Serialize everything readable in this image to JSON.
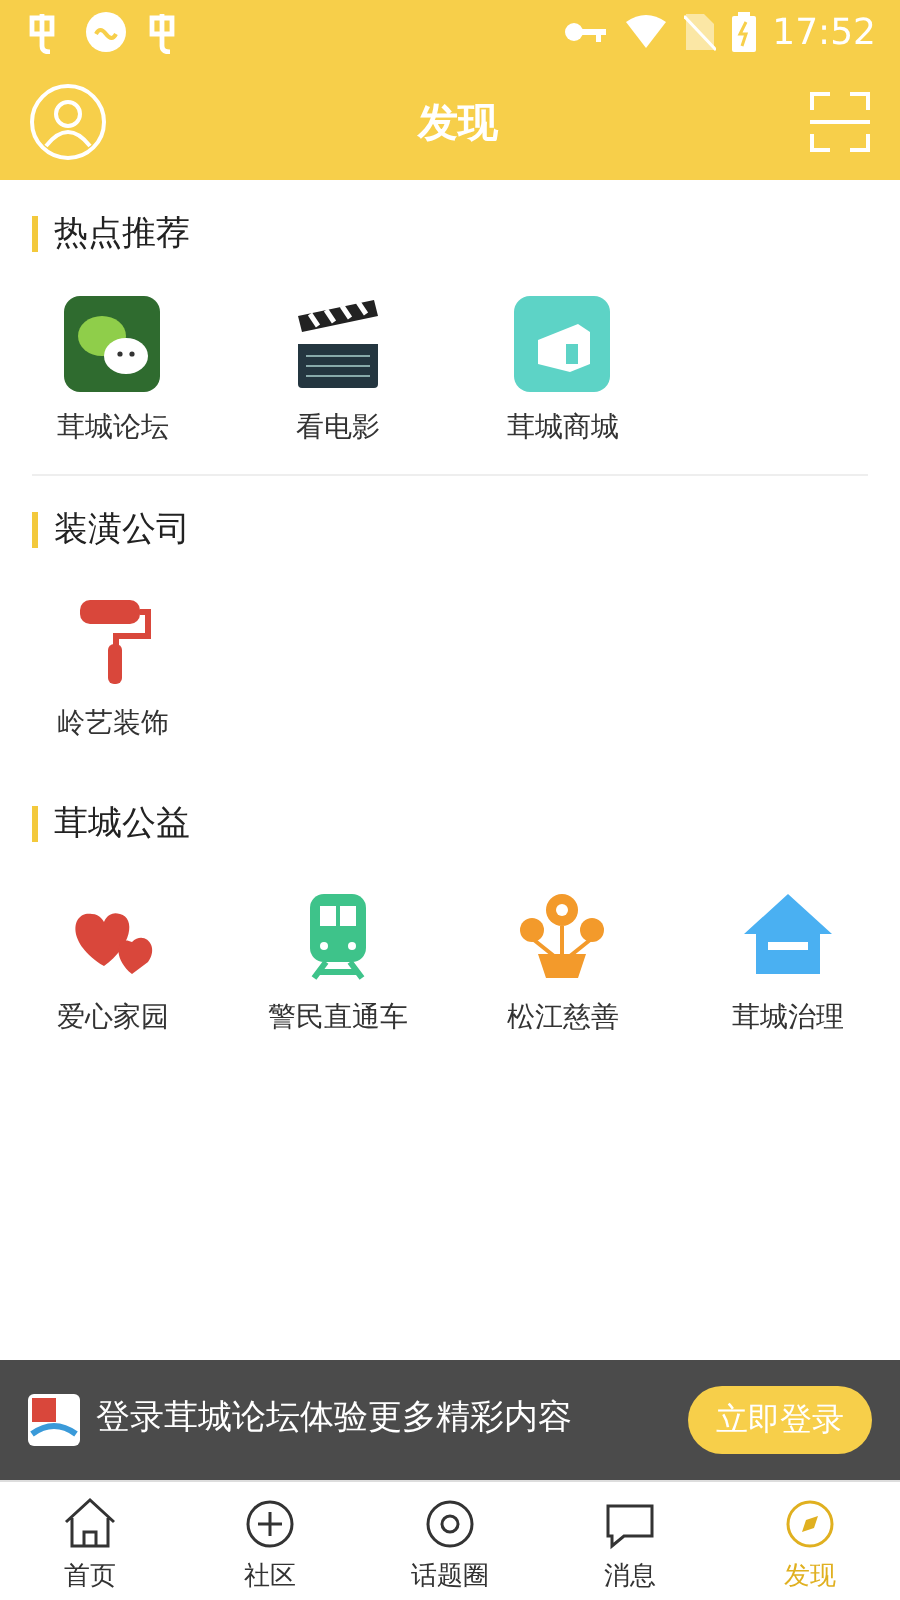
{
  "status_bar": {
    "time": "17:52"
  },
  "header": {
    "title": "发现"
  },
  "sections": [
    {
      "title": "热点推荐",
      "items": [
        {
          "label": "茸城论坛"
        },
        {
          "label": "看电影"
        },
        {
          "label": "茸城商城"
        }
      ]
    },
    {
      "title": "装潢公司",
      "items": [
        {
          "label": "岭艺装饰"
        }
      ]
    },
    {
      "title": "茸城公益",
      "items": [
        {
          "label": "爱心家园"
        },
        {
          "label": "警民直通车"
        },
        {
          "label": "松江慈善"
        },
        {
          "label": "茸城治理"
        }
      ]
    }
  ],
  "banner": {
    "text": "登录茸城论坛体验更多精彩内容",
    "button": "立即登录"
  },
  "tabs": [
    {
      "label": "首页",
      "selected": false
    },
    {
      "label": "社区",
      "selected": false
    },
    {
      "label": "话题圈",
      "selected": false
    },
    {
      "label": "消息",
      "selected": false
    },
    {
      "label": "发现",
      "selected": true
    }
  ]
}
